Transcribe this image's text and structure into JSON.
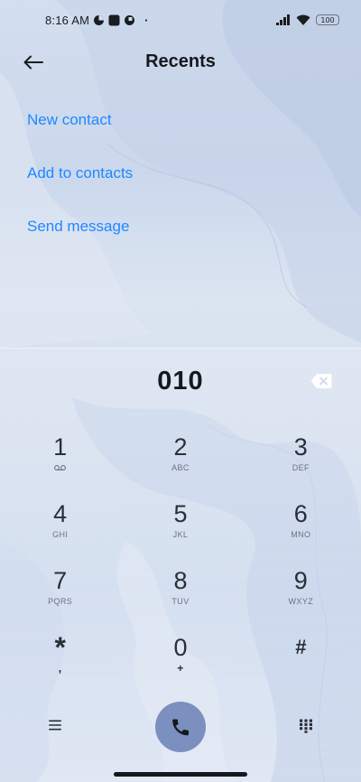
{
  "status_bar": {
    "time": "8:16 AM",
    "dot": "·",
    "battery_level": "100",
    "icons": [
      "data-saver-icon",
      "stop-icon",
      "app-notification-icon",
      "signal-icon",
      "wifi-icon",
      "battery-icon"
    ]
  },
  "header": {
    "title": "Recents",
    "back_icon": "back-arrow-icon"
  },
  "actions": [
    {
      "label": "New contact"
    },
    {
      "label": "Add to contacts"
    },
    {
      "label": "Send message"
    }
  ],
  "dialer": {
    "number": "010",
    "backspace_icon": "backspace-icon",
    "keys": [
      [
        {
          "digit": "1",
          "sub": ""
        },
        {
          "digit": "2",
          "sub": "ABC"
        },
        {
          "digit": "3",
          "sub": "DEF"
        }
      ],
      [
        {
          "digit": "4",
          "sub": "GHI"
        },
        {
          "digit": "5",
          "sub": "JKL"
        },
        {
          "digit": "6",
          "sub": "MNO"
        }
      ],
      [
        {
          "digit": "7",
          "sub": "PQRS"
        },
        {
          "digit": "8",
          "sub": "TUV"
        },
        {
          "digit": "9",
          "sub": "WXYZ"
        }
      ],
      [
        {
          "digit": "*",
          "sub": ","
        },
        {
          "digit": "0",
          "sub": "+"
        },
        {
          "digit": "#",
          "sub": ""
        }
      ]
    ],
    "bottom": {
      "menu_icon": "menu-icon",
      "call_icon": "phone-icon",
      "keypad_icon": "dialpad-icon"
    }
  },
  "colors": {
    "accent": "#1f88ff",
    "call_button": "#7b90bf"
  }
}
